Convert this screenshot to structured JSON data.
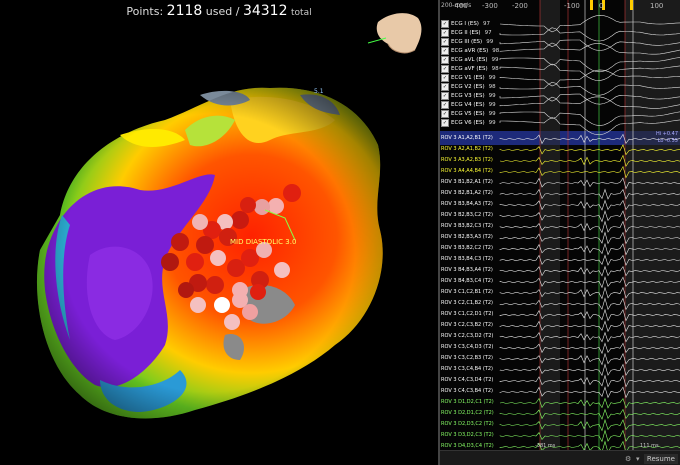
{
  "points": {
    "label": "Points:",
    "used": "2118",
    "used_label": "used /",
    "total": "34312",
    "total_label": "total"
  },
  "map": {
    "annotation": "MID DIASTOLIC 3.0",
    "scale_value": "5.1"
  },
  "traces": {
    "speed": "200 mm/s",
    "axis_ticks": [
      "-400",
      "-300",
      "-200",
      "-100",
      "0",
      "100"
    ],
    "hi_label": "Hi +0.47",
    "lo_label": "Lo -0.55",
    "ecg_rows": [
      {
        "label": "ECG I (ES)",
        "value": "97"
      },
      {
        "label": "ECG II (ES)",
        "value": "97"
      },
      {
        "label": "ECG III (ES)",
        "value": "99"
      },
      {
        "label": "ECG aVR (ES)",
        "value": "98"
      },
      {
        "label": "ECG aVL (ES)",
        "value": "99"
      },
      {
        "label": "ECG aVF (ES)",
        "value": "98"
      },
      {
        "label": "ECG V1 (ES)",
        "value": "99"
      },
      {
        "label": "ECG V2 (ES)",
        "value": "98"
      },
      {
        "label": "ECG V3 (ES)",
        "value": "99"
      },
      {
        "label": "ECG V4 (ES)",
        "value": "99"
      },
      {
        "label": "ECG V5 (ES)",
        "value": "99"
      },
      {
        "label": "ECG V6 (ES)",
        "value": "99"
      }
    ],
    "channels": [
      {
        "label": "ROV 3   A1,A2,B1 (T2)",
        "color": "white"
      },
      {
        "label": "ROV 3   A2,A1,B2 (T2)",
        "color": "yellow"
      },
      {
        "label": "ROV 3   A3,A2,B3 (T2)",
        "color": "yellow"
      },
      {
        "label": "ROV 3   A4,A4,B4 (T2)",
        "color": "yellow"
      },
      {
        "label": "ROV 3   B1,B2,A1 (T2)",
        "color": "white"
      },
      {
        "label": "ROV 3   B2,B1,A2 (T2)",
        "color": "white"
      },
      {
        "label": "ROV 3   B3,B4,A3 (T2)",
        "color": "white"
      },
      {
        "label": "ROV 3   B2,B3,C2 (T2)",
        "color": "white"
      },
      {
        "label": "ROV 3   B3,B2,C3 (T2)",
        "color": "white"
      },
      {
        "label": "ROV 3   B2,B3,A3 (T2)",
        "color": "white"
      },
      {
        "label": "ROV 3   B3,B2,C2 (T2)",
        "color": "white"
      },
      {
        "label": "ROV 3   B3,B4,C3 (T2)",
        "color": "white"
      },
      {
        "label": "ROV 3   B4,B3,A4 (T2)",
        "color": "white"
      },
      {
        "label": "ROV 3   B4,B3,C4 (T2)",
        "color": "white"
      },
      {
        "label": "ROV 3   C1,C2,B1 (T2)",
        "color": "white"
      },
      {
        "label": "ROV 3   C2,C1,B2 (T2)",
        "color": "white"
      },
      {
        "label": "ROV 3   C1,C2,D1 (T2)",
        "color": "white"
      },
      {
        "label": "ROV 3   C2,C3,B2 (T2)",
        "color": "white"
      },
      {
        "label": "ROV 3   C2,C3,D2 (T2)",
        "color": "white"
      },
      {
        "label": "ROV 3   C3,C4,D3 (T2)",
        "color": "white"
      },
      {
        "label": "ROV 3   C3,C2,B3 (T2)",
        "color": "white"
      },
      {
        "label": "ROV 3   C3,C4,B4 (T2)",
        "color": "white"
      },
      {
        "label": "ROV 3   C4,C3,D4 (T2)",
        "color": "white"
      },
      {
        "label": "ROV 3   C4,C3,B4 (T2)",
        "color": "white"
      },
      {
        "label": "ROV 3   D1,D2,C1 (T2)",
        "color": "green"
      },
      {
        "label": "ROV 3   D2,D1,C2 (T2)",
        "color": "green"
      },
      {
        "label": "ROV 3   D2,D3,C2 (T2)",
        "color": "green"
      },
      {
        "label": "ROV 3   D3,D2,C3 (T2)",
        "color": "green"
      },
      {
        "label": "ROV 3   D4,D3,C4 (T2)",
        "color": "green"
      }
    ],
    "ms_left": "-381 ms",
    "ms_right": "111 ms",
    "resume_label": "Resume"
  },
  "colors": {
    "selected_band": "#1d2a7a",
    "accent_yellow": "#ffff33",
    "accent_green": "#88ff66"
  }
}
